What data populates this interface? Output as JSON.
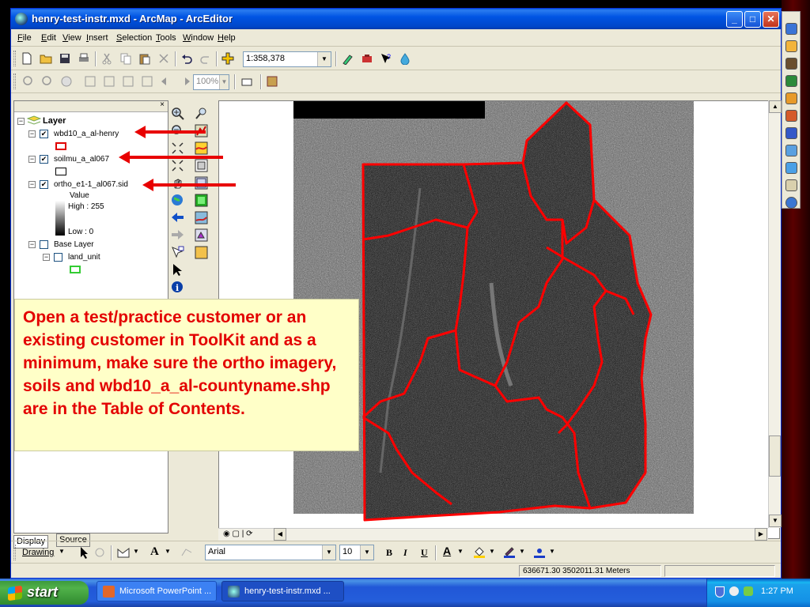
{
  "window": {
    "title": "henry-test-instr.mxd - ArcMap - ArcEditor",
    "buttons": {
      "minimize": "_",
      "maximize": "□",
      "close": "✕"
    }
  },
  "menu": {
    "items": [
      "File",
      "Edit",
      "View",
      "Insert",
      "Selection",
      "Tools",
      "Window",
      "Help"
    ]
  },
  "standard_toolbar": {
    "scale_value": "1:358,378"
  },
  "layout_toolbar": {
    "zoom_percent": "100%"
  },
  "toc": {
    "root_label": "Layer",
    "layers": [
      {
        "name": "wbd10_a_al-henry",
        "checked": true,
        "swatch_color": "#e00000"
      },
      {
        "name": "soilmu_a_al067",
        "checked": true,
        "swatch_color": "#000000"
      },
      {
        "name": "ortho_e1-1_al067.sid",
        "checked": true,
        "value_label": "Value",
        "high_label": "High : 255",
        "low_label": "Low : 0"
      }
    ],
    "base_layer": {
      "name": "Base Layer",
      "checked": false,
      "child": "land_unit",
      "swatch_color": "#33cc33"
    },
    "tabs": [
      "Display",
      "Source"
    ]
  },
  "callout": {
    "text": "Open a test/practice customer or an existing customer in ToolKit and as a minimum, make sure the ortho imagery, soils and wbd10_a_al-countyname.shp are in the Table of Contents."
  },
  "drawing_toolbar": {
    "drawing_label": "Drawing",
    "font_name": "Arial",
    "font_size": "10",
    "bold": "B",
    "italic": "I",
    "underline": "U",
    "font_color_label": "A"
  },
  "status_bar": {
    "coordinates": "636671.30  3502011.31 Meters"
  },
  "taskbar": {
    "start_label": "start",
    "tasks": [
      "Microsoft PowerPoint ...",
      "henry-test-instr.mxd ..."
    ],
    "clock": "1:27 PM"
  },
  "colors": {
    "annotation_red": "#e30000",
    "callout_background": "#ffffc8",
    "boundary_red": "#ff0000"
  }
}
